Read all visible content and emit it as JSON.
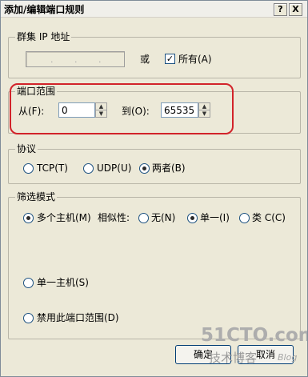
{
  "window": {
    "title": "添加/编辑端口规则",
    "help_label": "?",
    "close_label": "X"
  },
  "cluster_ip": {
    "group_label": "群集 IP 地址",
    "or_label": "或",
    "all_checked": true,
    "all_mark": "✓",
    "all_label": "所有(A)"
  },
  "port_range": {
    "group_label": "端口范围",
    "from_label": "从(F):",
    "from_value": "0",
    "to_label": "到(O):",
    "to_value": "65535"
  },
  "protocol": {
    "group_label": "协议",
    "options": [
      {
        "label": "TCP(T)",
        "checked": false
      },
      {
        "label": "UDP(U)",
        "checked": false
      },
      {
        "label": "两者(B)",
        "checked": true
      }
    ]
  },
  "filter_mode": {
    "group_label": "筛选模式",
    "multi_host_label": "多个主机(M)",
    "affinity_label": "相似性:",
    "affinity_options": [
      {
        "label": "无(N)",
        "checked": false
      },
      {
        "label": "单一(I)",
        "checked": true
      },
      {
        "label": "类 C(C)",
        "checked": false
      }
    ],
    "single_host_label": "单一主机(S)",
    "disable_label": "禁用此端口范围(D)"
  },
  "buttons": {
    "ok_label": "确定",
    "cancel_label": "取消"
  },
  "watermark": {
    "site": "51CTO.com",
    "sub": "技术博客",
    "blog": "Blog"
  },
  "colors": {
    "dialog_bg": "#ece9d8",
    "highlight": "#d2232a",
    "control_border": "#1c5180"
  }
}
